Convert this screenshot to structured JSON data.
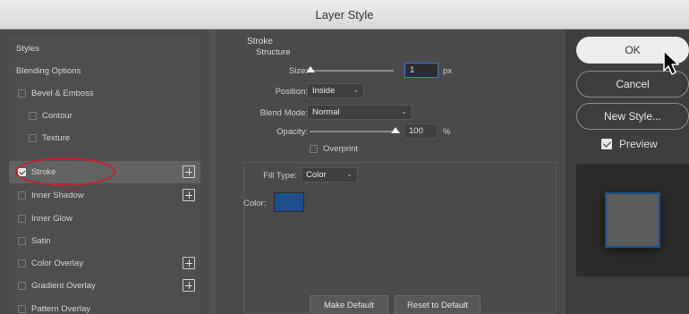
{
  "window": {
    "title": "Layer Style"
  },
  "styles_list": {
    "header": "Styles",
    "blending_options": "Blending Options",
    "items": [
      {
        "label": "Bevel & Emboss",
        "checked": false,
        "sub": false,
        "has_plus": false
      },
      {
        "label": "Contour",
        "checked": false,
        "sub": true,
        "has_plus": false
      },
      {
        "label": "Texture",
        "checked": false,
        "sub": true,
        "has_plus": false
      },
      {
        "label": "Stroke",
        "checked": true,
        "sub": false,
        "has_plus": true,
        "selected": true
      },
      {
        "label": "Inner Shadow",
        "checked": false,
        "sub": false,
        "has_plus": true
      },
      {
        "label": "Inner Glow",
        "checked": false,
        "sub": false,
        "has_plus": false
      },
      {
        "label": "Satin",
        "checked": false,
        "sub": false,
        "has_plus": false
      },
      {
        "label": "Color Overlay",
        "checked": false,
        "sub": false,
        "has_plus": true
      },
      {
        "label": "Gradient Overlay",
        "checked": false,
        "sub": false,
        "has_plus": true
      },
      {
        "label": "Pattern Overlay",
        "checked": false,
        "sub": false,
        "has_plus": false
      }
    ]
  },
  "stroke": {
    "title": "Stroke",
    "structure_label": "Structure",
    "size_label": "Size:",
    "size_value": "1",
    "size_unit": "px",
    "position_label": "Position:",
    "position_value": "Inside",
    "blend_mode_label": "Blend Mode:",
    "blend_mode_value": "Normal",
    "opacity_label": "Opacity:",
    "opacity_value": "100",
    "opacity_unit": "%",
    "overprint_label": "Overprint",
    "overprint_checked": false,
    "fill_type_label": "Fill Type:",
    "fill_type_value": "Color",
    "color_label": "Color:",
    "color_hex": "#1f4e8c",
    "make_default_label": "Make Default",
    "reset_default_label": "Reset to Default"
  },
  "actions": {
    "ok_label": "OK",
    "cancel_label": "Cancel",
    "new_style_label": "New Style...",
    "preview_label": "Preview",
    "preview_checked": true
  },
  "icons": [
    "chevron-down-icon",
    "plus-icon",
    "checkbox-icon",
    "cursor-arrow-icon"
  ],
  "colors": {
    "highlight_circle": "#c8202f",
    "stroke_color": "#1f4e8c"
  }
}
